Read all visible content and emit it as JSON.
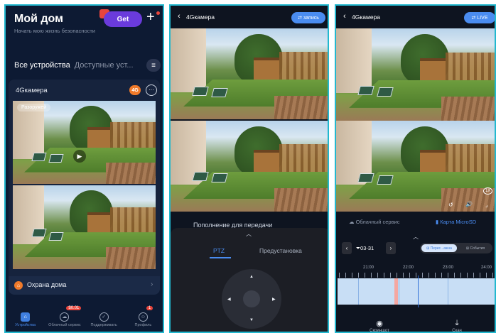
{
  "screen1": {
    "title": "Мой дом",
    "subtitle": "Начать мою жизнь безопасности",
    "get_label": "Get",
    "plus_label": "+",
    "tabs": [
      "Все устройства",
      "Доступные уст..."
    ],
    "menu_icon": "≡",
    "card": {
      "camera_name": "4Gкамера",
      "badge_4g": "4G",
      "more_icon": "···",
      "disarm_label": "Разоружей",
      "play_icon": "▶"
    },
    "guard": {
      "label": "Охрана дома",
      "arrow": "›"
    },
    "nav": [
      {
        "label": "Устройства",
        "icon": "⌂",
        "active": true
      },
      {
        "label": "Облачный сервис",
        "icon": "☁",
        "badge": "$0.01"
      },
      {
        "label": "Поддерживать",
        "icon": "✓"
      },
      {
        "label": "Профиль",
        "icon": "☺",
        "badge": "1"
      }
    ]
  },
  "screen2": {
    "back": "‹",
    "camera_name": "4Gкамера",
    "record_label": "⇄ запись",
    "notice": "Пополнение для передачи",
    "grabber": "︿",
    "tab_ptz": "PTZ",
    "tab_preset": "Предустановка",
    "dpad": {
      "up": "▲",
      "down": "▼",
      "left": "◀",
      "right": "▶"
    }
  },
  "screen3": {
    "back": "‹",
    "camera_name": "4Gкамера",
    "live_label": "⇄ LIVE",
    "zoom_label": "1X",
    "side_icons": {
      "replay": "↺",
      "volume": "🔊",
      "fullscreen": "⌟"
    },
    "service_cloud": "☁ Облачный сервис",
    "service_sd": "▮ Карта MicroSD",
    "grabber": "︿",
    "date": {
      "prev": "‹",
      "value": "⏷03-31",
      "next": "›"
    },
    "segment": {
      "a": "⊞ Перис...ажна",
      "b": "⊞ События"
    },
    "times": [
      "21:00",
      "22:00",
      "23:00",
      "24:00"
    ],
    "tools": [
      {
        "icon": "◉",
        "label": "Скриншот"
      },
      {
        "icon": "⤓",
        "label": "Скач"
      }
    ]
  },
  "colors": {
    "accent": "#4a8cf0",
    "frame": "#22b8cf",
    "badge_orange": "#f07a2a",
    "alert_red": "#e8453c",
    "timeline_fill": "#c8def5"
  }
}
